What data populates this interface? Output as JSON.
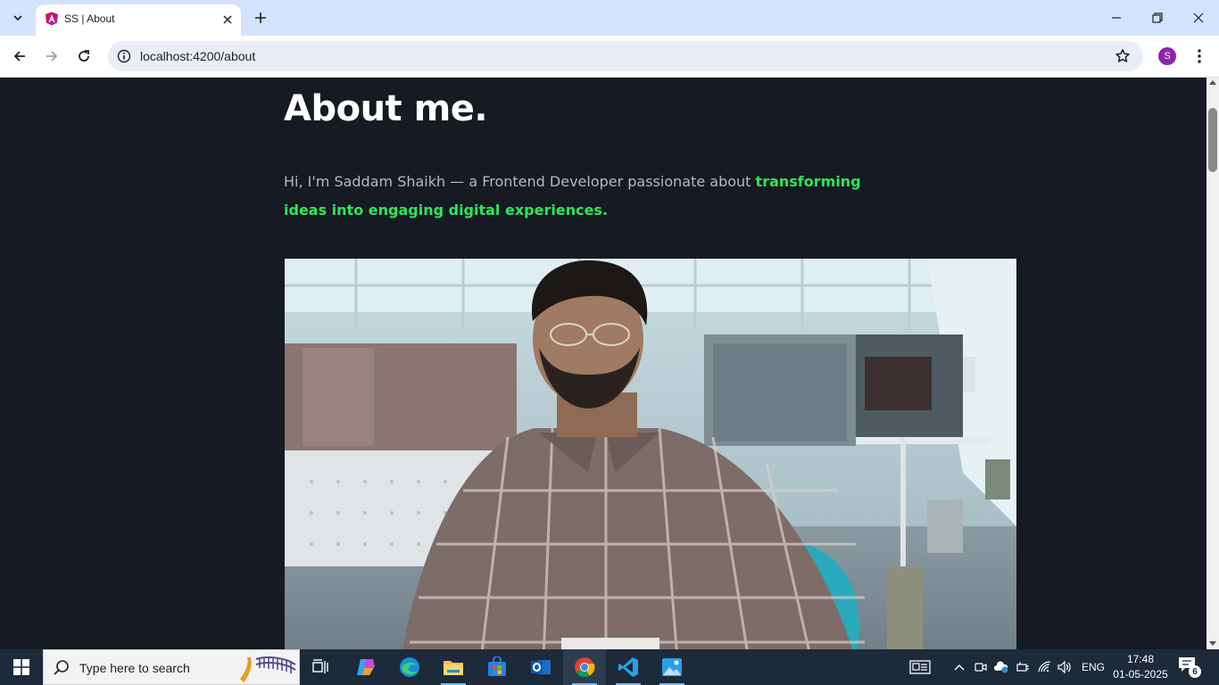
{
  "browser": {
    "tab": {
      "title": "SS | About"
    },
    "address": {
      "url": "localhost:4200/about"
    },
    "profile": {
      "initial": "S"
    }
  },
  "page": {
    "heading": "About me.",
    "intro": {
      "text": "Hi, I'm Saddam Shaikh — a Frontend Developer passionate about ",
      "highlight": "transforming ideas into engaging digital experiences."
    },
    "photo": {
      "subject": "portrait-in-office"
    }
  },
  "taskbar": {
    "search": {
      "placeholder": "Type here to search"
    },
    "apps": [
      "task-view",
      "copilot",
      "edge",
      "file-explorer",
      "microsoft-store",
      "outlook",
      "chrome",
      "vscode",
      "photos"
    ],
    "tray": {
      "language": "ENG",
      "time": "17:48",
      "date": "01-05-2025",
      "notifications": "6"
    }
  },
  "colors": {
    "page_bg": "#161a22",
    "accent_green": "#2ee65a",
    "tabstrip_bg": "#d3e3fd",
    "taskbar_bg": "#1c2a3a"
  }
}
